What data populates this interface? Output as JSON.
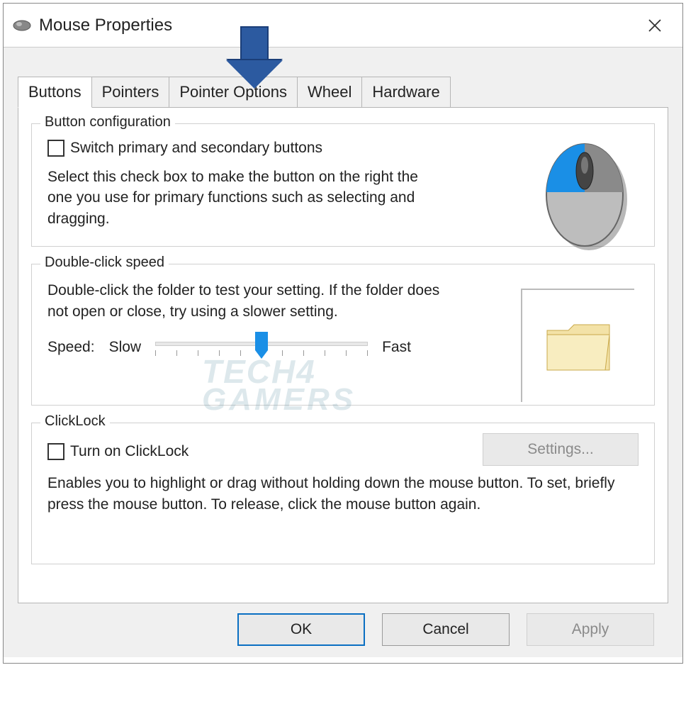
{
  "window": {
    "title": "Mouse Properties"
  },
  "tabs": [
    {
      "label": "Buttons",
      "active": true
    },
    {
      "label": "Pointers",
      "active": false
    },
    {
      "label": "Pointer Options",
      "active": false
    },
    {
      "label": "Wheel",
      "active": false
    },
    {
      "label": "Hardware",
      "active": false
    }
  ],
  "button_config": {
    "group_title": "Button configuration",
    "checkbox_label": "Switch primary and secondary buttons",
    "description": "Select this check box to make the button on the right the one you use for primary functions such as selecting and dragging."
  },
  "double_click": {
    "group_title": "Double-click speed",
    "description": "Double-click the folder to test your setting. If the folder does not open or close, try using a slower setting.",
    "speed_label": "Speed:",
    "slow_label": "Slow",
    "fast_label": "Fast"
  },
  "clicklock": {
    "group_title": "ClickLock",
    "checkbox_label": "Turn on ClickLock",
    "settings_label": "Settings...",
    "description": "Enables you to highlight or drag without holding down the mouse button. To set, briefly press the mouse button. To release, click the mouse button again."
  },
  "buttons": {
    "ok": "OK",
    "cancel": "Cancel",
    "apply": "Apply"
  },
  "watermark": {
    "line1": "TECH4",
    "line2": "GAMERS"
  }
}
